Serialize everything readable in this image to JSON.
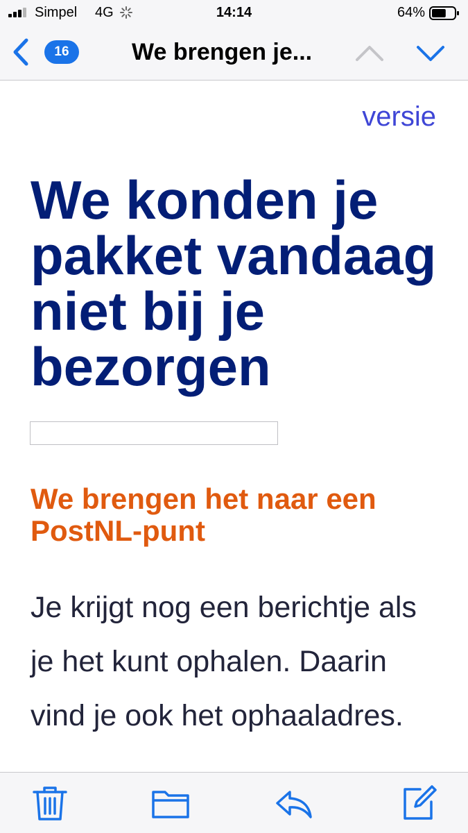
{
  "status_bar": {
    "carrier": "Simpel",
    "network": "4G",
    "time": "14:14",
    "battery_percent": "64%",
    "battery_level": 0.64
  },
  "nav": {
    "unread_count": "16",
    "title": "We brengen je..."
  },
  "email": {
    "version_link": "versie",
    "headline": "We konden je pakket vandaag niet bij je bezorgen",
    "subheading": "We brengen het naar een PostNL-punt",
    "body": "Je krijgt nog een berichtje als je het kunt ophalen. Daarin vind je ook het ophaaladres."
  },
  "toolbar": {
    "icons": [
      "trash-icon",
      "folder-icon",
      "reply-icon",
      "compose-icon"
    ]
  },
  "colors": {
    "accent": "#1a73e8",
    "headline": "#031e76",
    "subheading": "#e05a0f",
    "link": "#3f46d6"
  }
}
